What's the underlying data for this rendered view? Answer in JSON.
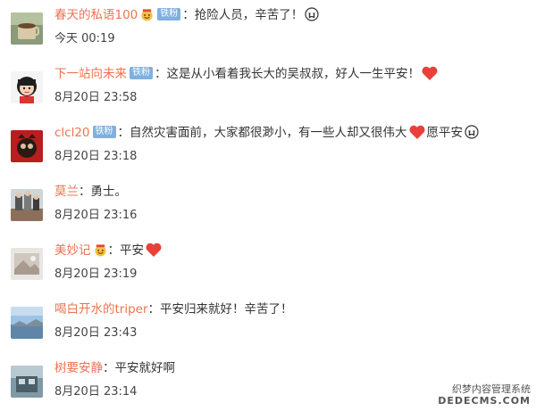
{
  "comments": [
    {
      "username": "春天的私语100",
      "badge": "铁粉",
      "text": "：抢险人员，辛苦了！",
      "time": "今天 00:19"
    },
    {
      "username": "下一站向未来",
      "badge": "铁粉",
      "text": "：这是从小看着我长大的吴叔叔，好人一生平安！",
      "time": "8月20日 23:58"
    },
    {
      "username": "clcl20",
      "badge": "铁粉",
      "text": "：自然灾害面前，大家都很渺小，有一些人却又很伟大",
      "text2": "愿平安",
      "time": "8月20日 23:18"
    },
    {
      "username": "莫兰",
      "badge": "",
      "text": "：勇士。",
      "time": "8月20日 23:16"
    },
    {
      "username": "美妙记",
      "badge": "",
      "text": "：平安",
      "time": "8月20日 23:19"
    },
    {
      "username": "喝白开水的triper",
      "badge": "",
      "text": "：平安归来就好！辛苦了！",
      "time": "8月20日 23:43"
    },
    {
      "username": "树要安静",
      "badge": "",
      "text": "：平安就好啊",
      "time": "8月20日 23:14"
    }
  ],
  "watermark": {
    "line1": "织梦内容管理系统",
    "line2": "DEDECMS.COM"
  },
  "colors": {
    "username": "#eb7350",
    "badge": "#7fb0e0",
    "heart": "#e8413a"
  }
}
